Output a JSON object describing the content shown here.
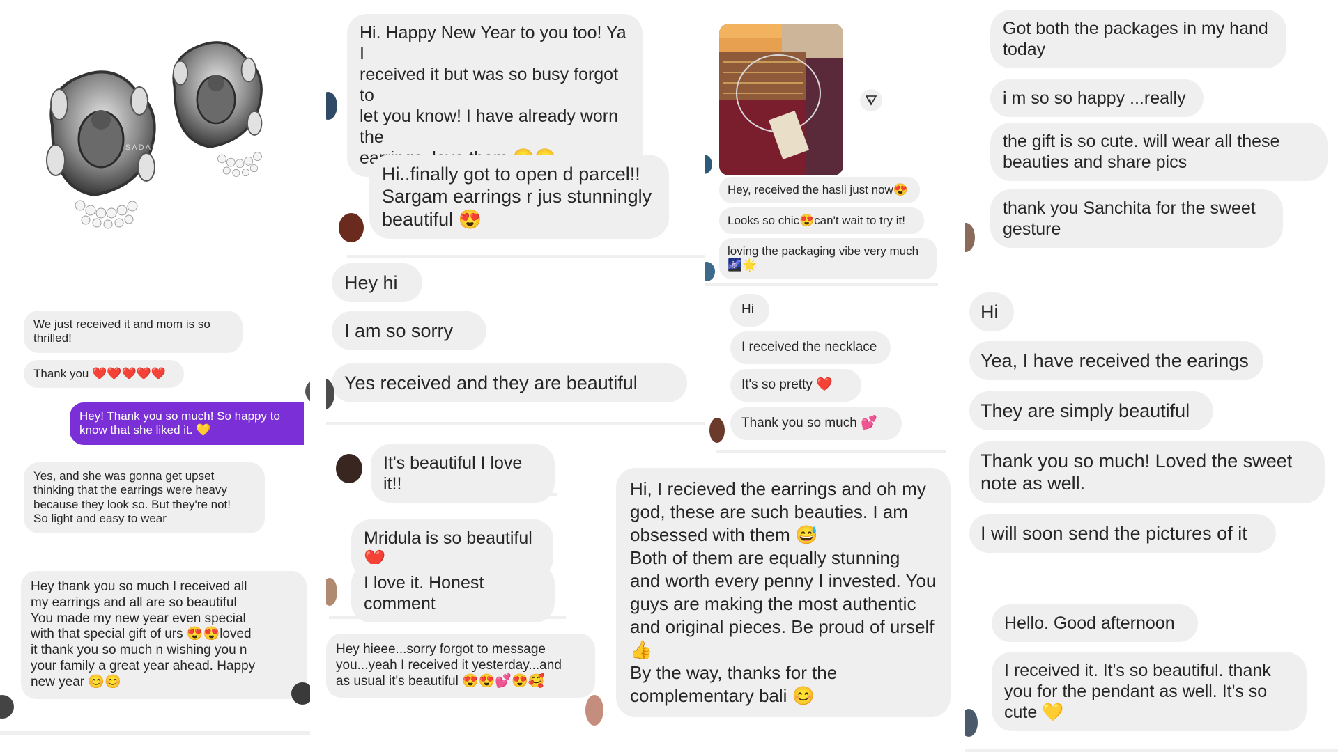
{
  "product": {
    "watermark": "SADABAHAAR"
  },
  "col1": {
    "msg1": "We just received it and mom is so\nthrilled!",
    "msg2": "Thank you ❤️❤️❤️❤️❤️",
    "sent": "Hey! Thank you so much! So happy to\nknow that she liked it. 💛",
    "msg3": "Yes, and she was gonna get upset\nthinking that the earrings were heavy\nbecause they look so. But they're not!\nSo light and easy to wear",
    "msg4": "Hey thank you so much I received all\nmy earrings and all are so beautiful\nYou made my new year even special\nwith that special gift of urs 😍😍loved\nit thank you so much n wishing you n\nyour family a great year ahead. Happy\nnew year 😊😊"
  },
  "col2": {
    "msg1": "Hi. Happy New Year to you too! Ya I\nreceived it but was so busy forgot to\nlet you know! I have already worn the\nearrings, love them 😊😊",
    "msg2": "Hi..finally got to open d parcel!!\nSargam earrings r jus stunningly\nbeautiful 😍",
    "msg3": "Hey hi",
    "msg4": "I am so sorry",
    "msg5": "Yes received and they are beautiful",
    "msg6": "It's beautiful I love it!!",
    "msg7": "Mridula is so beautiful ❤️",
    "msg8": "I love it. Honest comment",
    "msg9": "Hey hieee...sorry forgot to message\nyou...yeah I received it yesterday...and\nas usual it's beautiful 😍😍💕😍🥰"
  },
  "col3": {
    "msg1": "Hey, received the hasli just now😍",
    "msg2": "Looks so chic😍can't wait to try it!",
    "msg3": "loving the packaging vibe very much\n🌌🌟",
    "msg4": "Hi",
    "msg5": "I received the necklace",
    "msg6": "It's so pretty ❤️",
    "msg7": "Thank you so much 💕",
    "msg8": "Hi, I recieved the earrings and oh my\ngod, these are such beauties. I am\nobsessed with them 😅\nBoth of them are equally stunning\nand worth every penny I invested. You\nguys are making the most authentic\nand original pieces. Be proud of urself\n👍\nBy the way, thanks for the\ncomplementary bali 😊"
  },
  "col4": {
    "msg1": "Got both the packages in my hand\ntoday",
    "msg2": "i m so so happy ...really",
    "msg3": "the gift is so cute. will wear all these\nbeauties and share pics",
    "msg4": "thank you Sanchita for the sweet\ngesture",
    "msg5": "Hi",
    "msg6": "Yea, I have received the earings",
    "msg7": "They are simply beautiful",
    "msg8": "Thank you so much! Loved the sweet\nnote as well.",
    "msg9": "I will soon send the pictures of it",
    "msg10": "Hello. Good afternoon",
    "msg11": "I received it. It's so beautiful. thank\nyou for the pendant as well. It's so\ncute 💛"
  },
  "colors": {
    "bubble": "#efefef",
    "sent": "#7b2fd6",
    "text": "#262626"
  }
}
